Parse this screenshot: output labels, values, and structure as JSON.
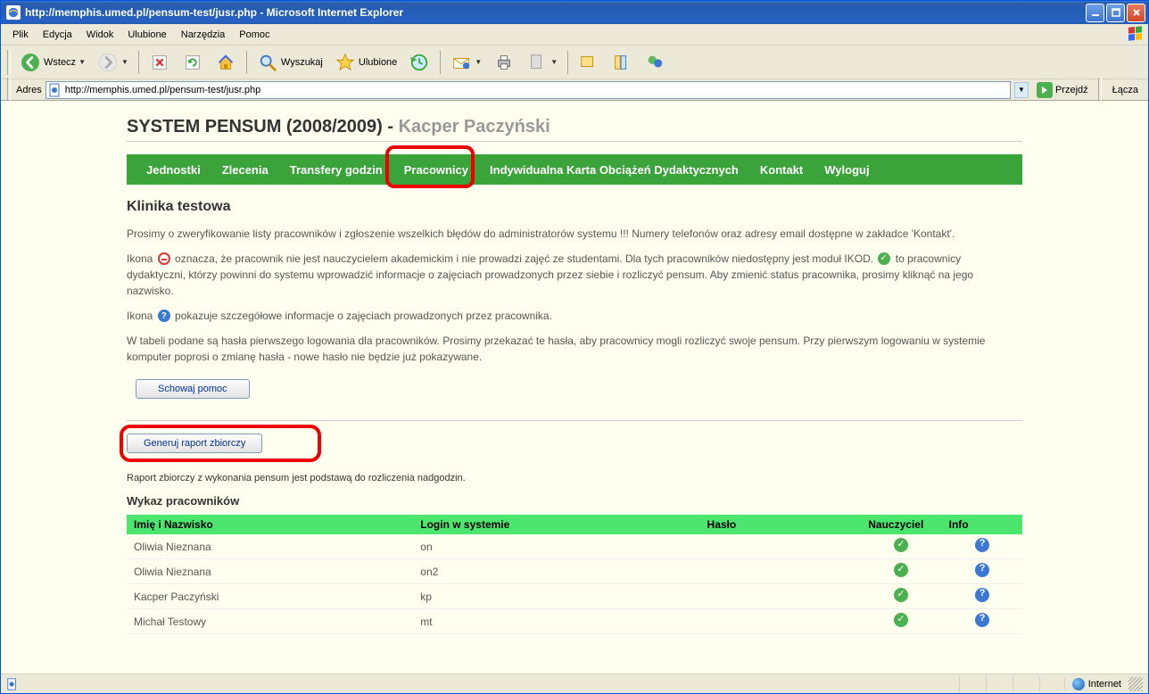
{
  "window": {
    "title": "http://memphis.umed.pl/pensum-test/jusr.php - Microsoft Internet Explorer"
  },
  "menubar": {
    "items": [
      "Plik",
      "Edycja",
      "Widok",
      "Ulubione",
      "Narzędzia",
      "Pomoc"
    ]
  },
  "toolbar": {
    "back": "Wstecz",
    "search": "Wyszukaj",
    "favorites": "Ulubione"
  },
  "addressbar": {
    "label": "Adres",
    "url": "http://memphis.umed.pl/pensum-test/jusr.php",
    "go": "Przejdź",
    "links": "Łącza"
  },
  "page": {
    "title_left": "SYSTEM PENSUM (2008/2009) - ",
    "title_user": "Kacper Paczyński",
    "nav": [
      "Jednostki",
      "Zlecenia",
      "Transfery godzin",
      "Pracownicy",
      "Indywidualna Karta Obciążeń Dydaktycznych",
      "Kontakt",
      "Wyloguj"
    ],
    "section_heading": "Klinika testowa",
    "para1": "Prosimy o zweryfikowanie listy pracowników i zgłoszenie wszelkich błędów do administratorów systemu !!! Numery telefonów oraz adresy email dostępne w zakładce 'Kontakt'.",
    "para2_a": "Ikona ",
    "para2_b": " oznacza, że pracownik nie jest nauczycielem akademickim i nie prowadzi zajęć ze studentami. Dla tych pracowników niedostępny jest moduł IKOD. ",
    "para2_c": " to pracownicy dydaktyczni, którzy powinni do systemu wprowadzić informacje o zajęciach prowadzonych przez siebie i rozliczyć pensum. Aby zmienić status pracownika, prosimy kliknąć na jego nazwisko.",
    "para3_a": "Ikona ",
    "para3_b": " pokazuje szczegółowe informacje o zajęciach prowadzonych przez pracownika.",
    "para4": "W tabeli podane są hasła pierwszego logowania dla pracowników. Prosimy przekazać te hasła, aby pracownicy mogli rozliczyć swoje pensum. Przy pierwszym logowaniu w systemie komputer poprosi o zmianę hasła - nowe hasło nie będzie już pokazywane.",
    "btn_hide_help": "Schowaj pomoc",
    "btn_generate": "Generuj raport zbiorczy",
    "note": "Raport zbiorczy z wykonania pensum jest podstawą do rozliczenia nadgodzin.",
    "table_heading": "Wykaz pracowników",
    "table": {
      "headers": [
        "Imię i Nazwisko",
        "Login w systemie",
        "Hasło",
        "Nauczyciel",
        "Info"
      ],
      "rows": [
        {
          "name": "Oliwia Nieznana",
          "login": "on",
          "pass": "",
          "teacher": true
        },
        {
          "name": "Oliwia Nieznana",
          "login": "on2",
          "pass": "",
          "teacher": true
        },
        {
          "name": "Kacper Paczyński",
          "login": "kp",
          "pass": "",
          "teacher": true
        },
        {
          "name": "Michał Testowy",
          "login": "mt",
          "pass": "",
          "teacher": true
        }
      ]
    }
  },
  "statusbar": {
    "zone": "Internet"
  }
}
